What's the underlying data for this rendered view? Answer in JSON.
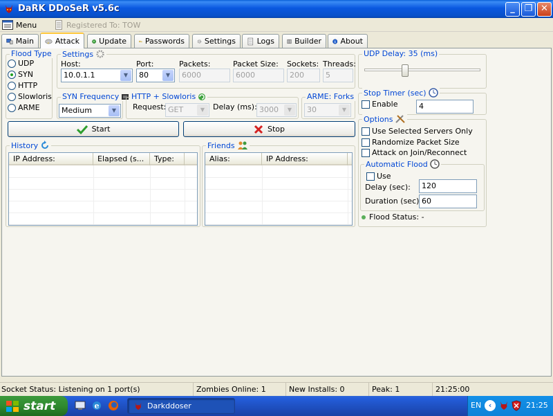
{
  "window": {
    "title": "DaRK DDoSeR v5.6c"
  },
  "menubar": {
    "menu_label": "Menu",
    "registered": "Registered To: TOW"
  },
  "tabs": [
    {
      "label": "Main",
      "icon": "computer-icon"
    },
    {
      "label": "Attack",
      "icon": "cloud-icon"
    },
    {
      "label": "Update",
      "icon": "globe-icon"
    },
    {
      "label": "Passwords",
      "icon": "key-icon"
    },
    {
      "label": "Settings",
      "icon": "gear-icon"
    },
    {
      "label": "Logs",
      "icon": "log-icon"
    },
    {
      "label": "Builder",
      "icon": "builder-icon"
    },
    {
      "label": "About",
      "icon": "info-icon"
    }
  ],
  "flood_type": {
    "title": "Flood Type",
    "options": [
      "UDP",
      "SYN",
      "HTTP",
      "Slowloris",
      "ARME"
    ],
    "selected": "SYN"
  },
  "settings": {
    "title": "Settings",
    "host_label": "Host:",
    "host_value": "10.0.1.1",
    "port_label": "Port:",
    "port_value": "80",
    "packets_label": "Packets:",
    "packets_value": "6000",
    "packet_size_label": "Packet Size:",
    "packet_size_value": "6000",
    "sockets_label": "Sockets:",
    "sockets_value": "200",
    "threads_label": "Threads:",
    "threads_value": "5"
  },
  "syn_frequency": {
    "title": "SYN Frequency",
    "value": "Medium"
  },
  "http_slowloris": {
    "title": "HTTP + Slowloris",
    "request_label": "Request:",
    "request_value": "GET",
    "delay_label": "Delay (ms):",
    "delay_value": "3000"
  },
  "arme": {
    "title": "ARME: Forks",
    "value": "30"
  },
  "udp_delay": {
    "title": "UDP Delay: 35 (ms)"
  },
  "stop_timer": {
    "title": "Stop Timer (sec)",
    "enable_label": "Enable",
    "value": "4"
  },
  "options": {
    "title": "Options",
    "items": [
      "Use Selected Servers Only",
      "Randomize Packet Size",
      "Attack on Join/Reconnect"
    ]
  },
  "automatic_flood": {
    "title": "Automatic Flood",
    "use_label": "Use",
    "delay_label": "Delay (sec):",
    "delay_value": "120",
    "duration_label": "Duration (sec):",
    "duration_value": "60"
  },
  "flood_status": "Flood Status: -",
  "buttons": {
    "start": "Start",
    "stop": "Stop"
  },
  "history": {
    "title": "History",
    "columns": [
      "IP Address:",
      "Elapsed (s...",
      "Type:"
    ]
  },
  "friends": {
    "title": "Friends",
    "columns": [
      "Alias:",
      "IP Address:"
    ]
  },
  "statusbar": {
    "socket": "Socket Status: Listening on 1 port(s)",
    "zombies": "Zombies Online: 1",
    "installs": "New Installs: 0",
    "peak": "Peak: 1",
    "time": "21:25:00"
  },
  "taskbar": {
    "start_label": "start",
    "task_label": "Darkddoser",
    "lang": "EN",
    "clock": "21:25"
  },
  "colors": {
    "group_title": "#0046d5",
    "start_check": "#2e9e2e",
    "stop_x": "#d42020"
  }
}
